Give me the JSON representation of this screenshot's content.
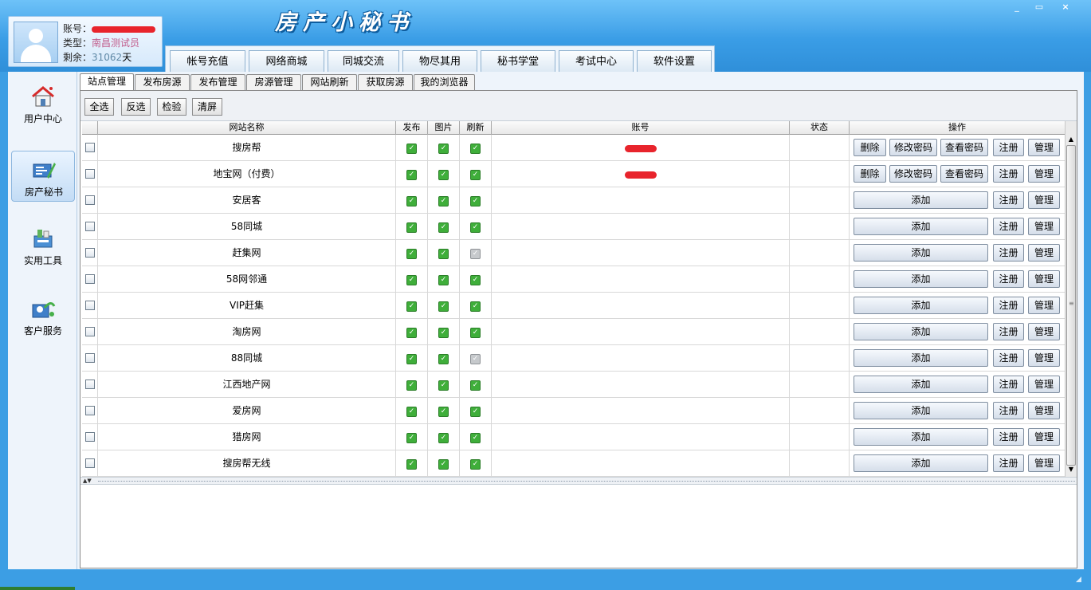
{
  "app": {
    "title": "房产小秘书",
    "window_controls": {
      "minimize": "_",
      "maximize": "▭",
      "close": "×"
    }
  },
  "user": {
    "account_label": "账号：",
    "type_label": "类型：",
    "type_value": "南昌测试员",
    "remain_label": "剩余：",
    "remain_value": "31062",
    "remain_unit": "天"
  },
  "nav_tabs": [
    "帐号充值",
    "网络商城",
    "同城交流",
    "物尽其用",
    "秘书学堂",
    "考试中心",
    "软件设置"
  ],
  "left_nav": [
    {
      "label": "用户中心",
      "icon": "house-icon"
    },
    {
      "label": "房产秘书",
      "icon": "secretary-icon",
      "active": true
    },
    {
      "label": "实用工具",
      "icon": "tools-icon"
    },
    {
      "label": "客户服务",
      "icon": "customer-service-icon"
    }
  ],
  "sub_tabs": [
    "站点管理",
    "发布房源",
    "发布管理",
    "房源管理",
    "网站刷新",
    "获取房源",
    "我的浏览器"
  ],
  "toolbar": [
    "全选",
    "反选",
    "检验",
    "清屏"
  ],
  "grid": {
    "headers": {
      "name": "网站名称",
      "publish": "发布",
      "image": "图片",
      "refresh": "刷新",
      "account": "账号",
      "status": "状态",
      "ops": "操作"
    },
    "buttons": {
      "delete": "删除",
      "change_pwd": "修改密码",
      "view_pwd": "查看密码",
      "add": "添加",
      "register": "注册",
      "manage": "管理"
    },
    "rows": [
      {
        "name": "搜房帮",
        "publish": true,
        "image": true,
        "refresh": true,
        "has_account": true
      },
      {
        "name": "地宝网（付费）",
        "publish": true,
        "image": true,
        "refresh": true,
        "has_account": true
      },
      {
        "name": "安居客",
        "publish": true,
        "image": true,
        "refresh": true,
        "has_account": false
      },
      {
        "name": "58同城",
        "publish": true,
        "image": true,
        "refresh": true,
        "has_account": false
      },
      {
        "name": "赶集网",
        "publish": true,
        "image": true,
        "refresh": false,
        "has_account": false
      },
      {
        "name": "58网邻通",
        "publish": true,
        "image": true,
        "refresh": true,
        "has_account": false
      },
      {
        "name": "VIP赶集",
        "publish": true,
        "image": true,
        "refresh": true,
        "has_account": false
      },
      {
        "name": "淘房网",
        "publish": true,
        "image": true,
        "refresh": true,
        "has_account": false
      },
      {
        "name": "88同城",
        "publish": true,
        "image": true,
        "refresh": false,
        "has_account": false
      },
      {
        "name": "江西地产网",
        "publish": true,
        "image": true,
        "refresh": true,
        "has_account": false
      },
      {
        "name": "爱房网",
        "publish": true,
        "image": true,
        "refresh": true,
        "has_account": false
      },
      {
        "name": "猎房网",
        "publish": true,
        "image": true,
        "refresh": true,
        "has_account": false
      },
      {
        "name": "搜房帮无线",
        "publish": true,
        "image": true,
        "refresh": true,
        "has_account": false
      }
    ]
  },
  "colors": {
    "title_bar": "#3a9de6",
    "redaction": "#e8242c",
    "check_on": "#3fae3a",
    "check_off": "#c6c9cc"
  }
}
